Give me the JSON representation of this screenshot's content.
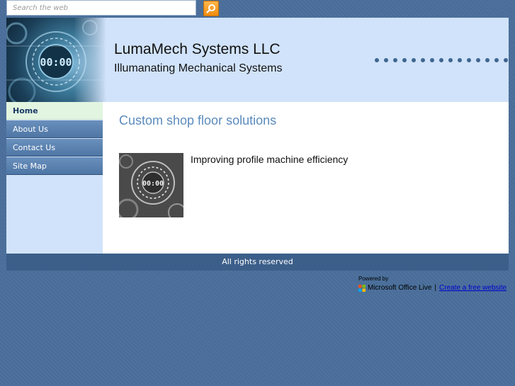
{
  "search": {
    "placeholder": "Search the web",
    "button_icon": "search-icon"
  },
  "header": {
    "title": "LumaMech Systems LLC",
    "tagline": "Illumanating Mechanical Systems",
    "art_icon": "gear-clock-image"
  },
  "nav": {
    "items": [
      {
        "label": "Home",
        "active": true
      },
      {
        "label": "About Us"
      },
      {
        "label": "Contact Us"
      },
      {
        "label": "Site Map"
      }
    ]
  },
  "main": {
    "heading": "Custom shop floor solutions",
    "caption": "Improving profile machine efficiency",
    "image_icon": "gear-clock-image"
  },
  "footer": {
    "text": "All rights reserved"
  },
  "powered": {
    "label": "Powered by",
    "brand": "Microsoft Office Live",
    "separator": "|",
    "link": "Create a free website"
  },
  "colors": {
    "background": "#4a6f9b",
    "header": "#d1e3fa",
    "nav": "#5b82b0",
    "nav_active": "#e2f5e0",
    "heading": "#5b8bbd",
    "footer": "#3c5f8a",
    "search_button": "#f08c10"
  }
}
